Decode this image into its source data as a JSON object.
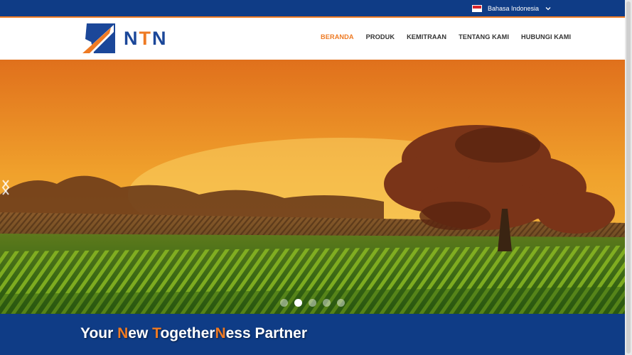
{
  "language": {
    "label": "Bahasa Indonesia"
  },
  "logo": {
    "letters": [
      "N",
      "T",
      "N"
    ]
  },
  "nav": {
    "items": [
      {
        "label": "BERANDA",
        "active": true
      },
      {
        "label": "PRODUK",
        "active": false
      },
      {
        "label": "KEMITRAAN",
        "active": false
      },
      {
        "label": "TENTANG KAMI",
        "active": false
      },
      {
        "label": "HUBUNGI KAMI",
        "active": false
      }
    ]
  },
  "slider": {
    "slide_count": 5,
    "active_index": 1
  },
  "tagline": {
    "parts": [
      {
        "text": "Your ",
        "highlight": false
      },
      {
        "text": "N",
        "highlight": true
      },
      {
        "text": "ew ",
        "highlight": false
      },
      {
        "text": "T",
        "highlight": true
      },
      {
        "text": "ogether",
        "highlight": false
      },
      {
        "text": "N",
        "highlight": true
      },
      {
        "text": "ess Partner",
        "highlight": false
      }
    ]
  },
  "colors": {
    "brand_blue": "#0f3c86",
    "brand_orange": "#ee7a23",
    "nav_text": "#333333"
  }
}
